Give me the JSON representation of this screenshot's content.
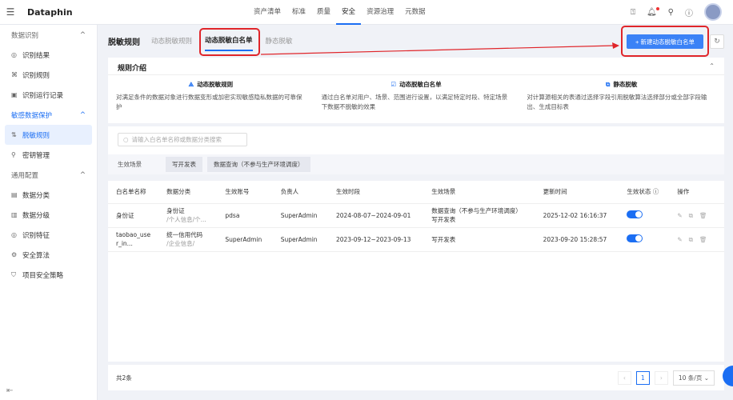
{
  "app": {
    "logo": "Dataphin",
    "nav": [
      "资产清单",
      "标准",
      "质量",
      "安全",
      "资源治理",
      "元数据"
    ],
    "active_nav": 3
  },
  "sidebar": {
    "groups": [
      {
        "label": "数据识别",
        "items": [
          "识别结果",
          "识别规则",
          "识别运行记录"
        ]
      },
      {
        "label": "敏感数据保护",
        "items": [
          "脱敏规则",
          "密钥管理"
        ]
      },
      {
        "label": "通用配置",
        "items": [
          "数据分类",
          "数据分级",
          "识别特征",
          "安全算法",
          "项目安全策略"
        ]
      }
    ]
  },
  "tabs": {
    "title": "脱敏规则",
    "items": [
      "动态脱敏规则",
      "动态脱敏白名单",
      "静态脱敏"
    ]
  },
  "new_button": "+ 新建动态脱敏白名单",
  "intro": {
    "title": "规则介绍",
    "cols": [
      {
        "title": "动态脱敏规则",
        "desc": "对满足条件的数据对象进行数据变形或加密实现敏感隐私数据的可靠保护"
      },
      {
        "title": "动态脱敏白名单",
        "desc": "通过白名单对用户、场景、范围进行设置，以满足特定时段、特定场景下数据不脱敏的效果"
      },
      {
        "title": "静态脱敏",
        "desc": "对计算源相关的表通过选择字段引用脱敏算法选择部分或全部字段输出、生成目标表"
      }
    ]
  },
  "filter": {
    "search_placeholder": "请输入白名单名称或数据分类搜索",
    "scene_label": "生效场景",
    "chips": [
      "写开发表",
      "数据查询（不参与生产环境调度）"
    ]
  },
  "table": {
    "headers": [
      "白名单名称",
      "数据分类",
      "生效账号",
      "负责人",
      "生效时段",
      "生效场景",
      "更新时间",
      "生效状态 ⓘ",
      "操作"
    ],
    "rows": [
      {
        "name": "身份证",
        "cat": "身份证",
        "cat_path": "/个人信息/个...",
        "account": "pdsa",
        "owner": "SuperAdmin",
        "period": "2024-08-07~2024-09-01",
        "scene1": "数据查询（不参与生产环境调度）",
        "scene2": "写开发表",
        "updated": "2025-12-02 16:16:37",
        "enabled": true
      },
      {
        "name": "taobao_user_in...",
        "cat": "统一信用代码",
        "cat_path": "/企业信息/",
        "account": "SuperAdmin",
        "owner": "SuperAdmin",
        "period": "2023-09-12~2023-09-13",
        "scene1": "写开发表",
        "scene2": "",
        "updated": "2023-09-20 15:28:57",
        "enabled": true
      }
    ]
  },
  "footer": {
    "total": "共2条",
    "page": "1",
    "page_size": "10 条/页"
  }
}
